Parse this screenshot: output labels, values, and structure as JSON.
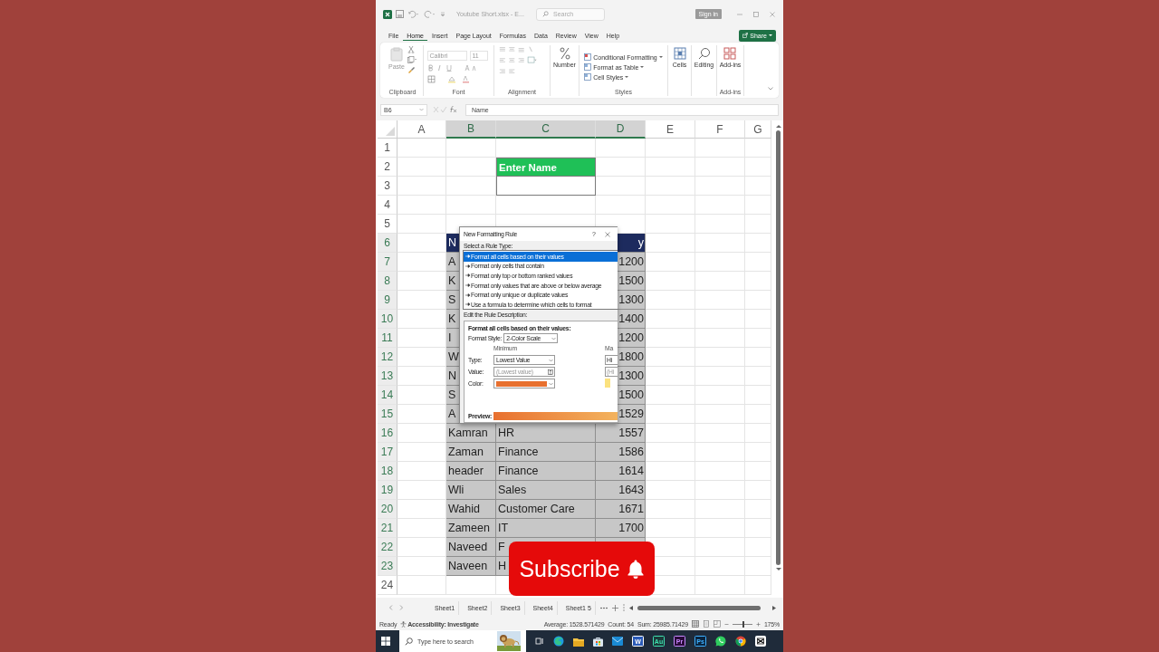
{
  "title_bar": {
    "file_title": "Youtube Short.xlsx - E...",
    "search_placeholder": "Search",
    "sign_in": "Sign in"
  },
  "ribbon_tabs": [
    {
      "label": "File",
      "selected": false
    },
    {
      "label": "Home",
      "selected": true
    },
    {
      "label": "Insert",
      "selected": false
    },
    {
      "label": "Page Layout",
      "selected": false
    },
    {
      "label": "Formulas",
      "selected": false
    },
    {
      "label": "Data",
      "selected": false
    },
    {
      "label": "Review",
      "selected": false
    },
    {
      "label": "View",
      "selected": false
    },
    {
      "label": "Help",
      "selected": false
    }
  ],
  "share": "Share",
  "ribbon_groups": [
    {
      "kind": "clipboard",
      "label": "Clipboard",
      "button": "Paste"
    },
    {
      "kind": "font",
      "label": "Font",
      "font_name": "Calibri",
      "font_size": "11"
    },
    {
      "kind": "alignment",
      "label": "Alignment"
    },
    {
      "kind": "number",
      "button": "Number"
    },
    {
      "kind": "styles",
      "label": "Styles",
      "items": [
        "Conditional Formatting",
        "Format as Table",
        "Cell Styles"
      ]
    },
    {
      "kind": "cells",
      "button": "Cells"
    },
    {
      "kind": "editing",
      "button": "Editing"
    },
    {
      "kind": "addins",
      "button": "Add-ins",
      "label": "Add-ins"
    }
  ],
  "formula_bar": {
    "name_box": "B6",
    "formula": "Name"
  },
  "columns": [
    {
      "label": "A",
      "selected": false
    },
    {
      "label": "B",
      "selected": true
    },
    {
      "label": "C",
      "selected": true
    },
    {
      "label": "D",
      "selected": true
    },
    {
      "label": "E",
      "selected": false
    },
    {
      "label": "F",
      "selected": false
    },
    {
      "label": "G",
      "selected": false
    }
  ],
  "rows": [
    {
      "num": "1",
      "selected": false,
      "kind": "blank"
    },
    {
      "num": "2",
      "selected": false,
      "kind": "title",
      "c": "Enter Name"
    },
    {
      "num": "3",
      "selected": false,
      "kind": "input"
    },
    {
      "num": "4",
      "selected": false,
      "kind": "blank"
    },
    {
      "num": "5",
      "selected": false,
      "kind": "blank"
    },
    {
      "num": "6",
      "selected": true,
      "kind": "header",
      "b": "N",
      "d": "y"
    },
    {
      "num": "7",
      "selected": true,
      "kind": "data",
      "b": "A",
      "d": "1200"
    },
    {
      "num": "8",
      "selected": true,
      "kind": "data",
      "b": "K",
      "d": "1500"
    },
    {
      "num": "9",
      "selected": true,
      "kind": "data",
      "b": "S",
      "d": "1300"
    },
    {
      "num": "10",
      "selected": true,
      "kind": "data",
      "b": "K",
      "d": "1400"
    },
    {
      "num": "11",
      "selected": true,
      "kind": "data",
      "b": "I",
      "d": "1200"
    },
    {
      "num": "12",
      "selected": true,
      "kind": "data",
      "b": "W",
      "d": "1800"
    },
    {
      "num": "13",
      "selected": true,
      "kind": "data",
      "b": "N",
      "d": "1300"
    },
    {
      "num": "14",
      "selected": true,
      "kind": "data",
      "b": "S",
      "d": "1500"
    },
    {
      "num": "15",
      "selected": true,
      "kind": "data",
      "b": "A",
      "d": "1529"
    },
    {
      "num": "16",
      "selected": true,
      "kind": "data",
      "b": "Kamran",
      "c": "HR",
      "d": "1557"
    },
    {
      "num": "17",
      "selected": true,
      "kind": "data",
      "b": "Zaman",
      "c": "Finance",
      "d": "1586"
    },
    {
      "num": "18",
      "selected": true,
      "kind": "data",
      "b": "header",
      "c": "Finance",
      "d": "1614"
    },
    {
      "num": "19",
      "selected": true,
      "kind": "data",
      "b": "Wli",
      "c": "Sales",
      "d": "1643"
    },
    {
      "num": "20",
      "selected": true,
      "kind": "data",
      "b": "Wahid",
      "c": "Customer Care",
      "d": "1671"
    },
    {
      "num": "21",
      "selected": true,
      "kind": "data",
      "b": "Zameen",
      "c": "IT",
      "d": "1700"
    },
    {
      "num": "22",
      "selected": true,
      "kind": "data",
      "b": "Naveed",
      "c": "F"
    },
    {
      "num": "23",
      "selected": true,
      "kind": "data",
      "b": "Naveen",
      "c": "H"
    },
    {
      "num": "24",
      "selected": false,
      "kind": "blank"
    }
  ],
  "dialog": {
    "title": "New Formatting Rule",
    "help": "?",
    "select_label": "Select a Rule Type:",
    "rule_types": [
      {
        "label": "Format all cells based on their values",
        "selected": true
      },
      {
        "label": "Format only cells that contain",
        "selected": false
      },
      {
        "label": "Format only top or bottom ranked values",
        "selected": false
      },
      {
        "label": "Format only values that are above or below average",
        "selected": false
      },
      {
        "label": "Format only unique or duplicate values",
        "selected": false
      },
      {
        "label": "Use a formula to determine which cells to format",
        "selected": false
      }
    ],
    "edit_label": "Edit the Rule Description:",
    "description_heading": "Format all cells based on their values:",
    "format_style_label": "Format Style:",
    "format_style": "2-Color Scale",
    "field_labels": [
      "Type:",
      "Value:",
      "Color:"
    ],
    "minimum": {
      "heading": "Minimum",
      "type": "Lowest Value",
      "value_placeholder": "(Lowest value)",
      "color": "#e8702f"
    },
    "maximum": {
      "heading": "Ma",
      "type": "Hi",
      "value_placeholder": "(Hi",
      "color": "#fbe27f"
    },
    "preview_label": "Preview:"
  },
  "subscribe": "Subscribe",
  "sheet_tabs": [
    "Sheet1",
    "Sheet2",
    "Sheet3",
    "Sheet4",
    "Sheet1 5"
  ],
  "status_bar": {
    "ready": "Ready",
    "accessibility": "Accessibility: Investigate",
    "average": "Average: 1528.571429",
    "count": "Count: 54",
    "sum": "Sum: 25985.71429",
    "zoom_slider": {
      "level": 0.55
    },
    "zoom": "175%"
  },
  "taskbar": {
    "search_placeholder": "Type here to search",
    "apps": [
      {
        "kind": "task-view"
      },
      {
        "kind": "edge"
      },
      {
        "kind": "files"
      },
      {
        "kind": "store"
      },
      {
        "kind": "mail"
      },
      {
        "kind": "word",
        "label": "W"
      },
      {
        "kind": "audition",
        "label": "Au"
      },
      {
        "kind": "premiere",
        "label": "Pr"
      },
      {
        "kind": "photoshop",
        "label": "Ps"
      },
      {
        "kind": "whatsapp"
      },
      {
        "kind": "chrome"
      },
      {
        "kind": "capcut"
      }
    ]
  }
}
